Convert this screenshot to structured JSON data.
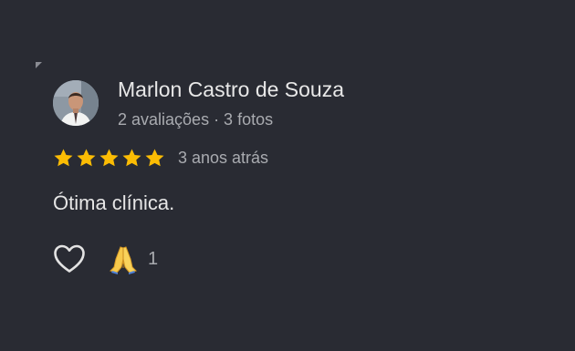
{
  "review": {
    "author": {
      "name": "Marlon Castro de Souza",
      "meta": "2 avaliações · 3 fotos"
    },
    "rating": {
      "value": 5,
      "max": 5,
      "star_color": "#fbbc04"
    },
    "date": "3 anos atrás",
    "text": "Ótima clínica.",
    "actions": {
      "like_icon": "heart-outline-icon",
      "reaction_icon": "folded-hands-emoji",
      "reaction_count": "1"
    }
  }
}
